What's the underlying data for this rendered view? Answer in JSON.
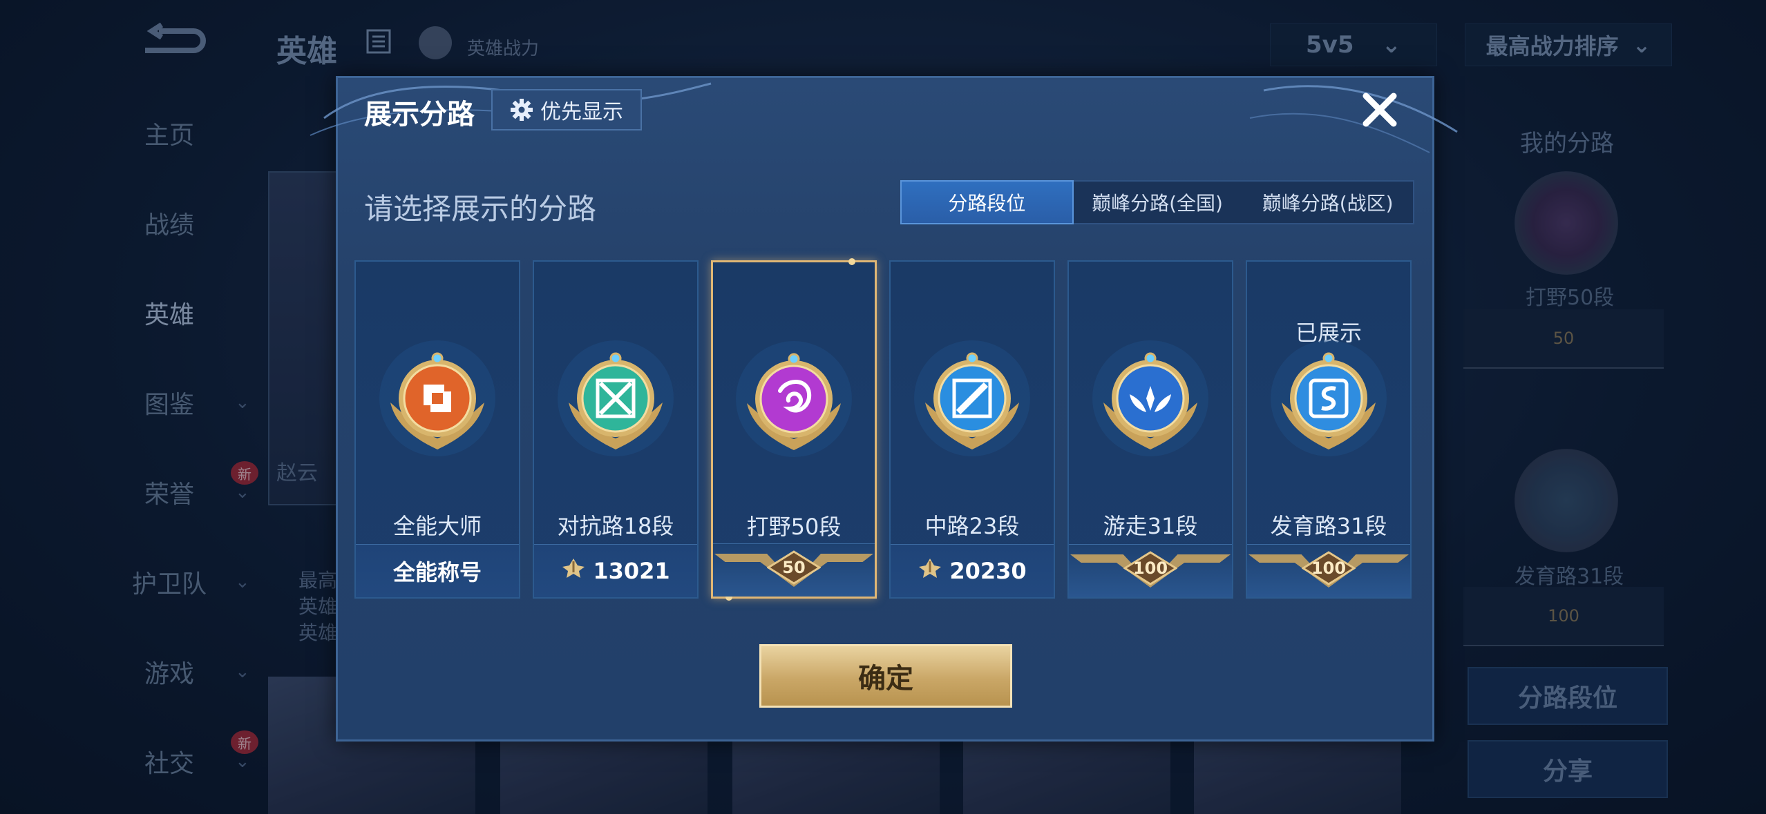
{
  "background": {
    "header_title": "英雄",
    "power_label": "英雄战力",
    "mode_select": "5v5",
    "sort_select": "最高战力排序",
    "nav": [
      {
        "label": "主页",
        "chevron": false,
        "new": false
      },
      {
        "label": "战绩",
        "chevron": false,
        "new": false
      },
      {
        "label": "英雄",
        "chevron": false,
        "new": false,
        "active": true
      },
      {
        "label": "图鉴",
        "chevron": true,
        "new": false
      },
      {
        "label": "荣誉",
        "chevron": true,
        "new": true
      },
      {
        "label": "护卫队",
        "chevron": true,
        "new": false
      },
      {
        "label": "游戏",
        "chevron": true,
        "new": false
      },
      {
        "label": "社交",
        "chevron": true,
        "new": true
      }
    ],
    "new_badge": "新",
    "hero_tag": "赵云",
    "hero_lines": [
      "最高",
      "英雄",
      "英雄"
    ],
    "right_panel": {
      "title": "我的分路",
      "item1_label": "打野50段",
      "item1_rank": "50",
      "item2_label": "发育路31段",
      "item2_rank": "100",
      "btn_lane_rank": "分路段位",
      "btn_share": "分享"
    }
  },
  "dialog": {
    "title": "展示分路",
    "priority_button": "优先显示",
    "subtitle": "请选择展示的分路",
    "tabs": [
      {
        "label": "分路段位",
        "active": true
      },
      {
        "label": "巅峰分路(全国)",
        "active": false
      },
      {
        "label": "巅峰分路(战区)",
        "active": false
      }
    ],
    "cards": [
      {
        "name": "全能大师",
        "footer_type": "text",
        "footer": "全能称号",
        "shown": "",
        "selected": false,
        "emblem_color": "#e0642a",
        "emblem_icon": "allround-icon"
      },
      {
        "name": "对抗路18段",
        "footer_type": "score",
        "footer": "13021",
        "shown": "",
        "selected": false,
        "emblem_color": "#2fb59a",
        "emblem_icon": "clash-lane-icon"
      },
      {
        "name": "打野50段",
        "footer_type": "rank",
        "footer": "50",
        "shown": "",
        "selected": true,
        "emblem_color": "#b23ad1",
        "emblem_icon": "jungle-dragon-icon"
      },
      {
        "name": "中路23段",
        "footer_type": "score",
        "footer": "20230",
        "shown": "",
        "selected": false,
        "emblem_color": "#2a8ee0",
        "emblem_icon": "mid-lane-icon"
      },
      {
        "name": "游走31段",
        "footer_type": "rank",
        "footer": "100",
        "shown": "",
        "selected": false,
        "emblem_color": "#2a6fd0",
        "emblem_icon": "roam-wings-icon"
      },
      {
        "name": "发育路31段",
        "footer_type": "rank",
        "footer": "100",
        "shown": "已展示",
        "selected": false,
        "emblem_color": "#2f8de0",
        "emblem_icon": "farm-lane-icon"
      }
    ],
    "confirm_button": "确定"
  },
  "colors": {
    "accent_blue": "#2f6fbf",
    "gold": "#e0b775",
    "card_bg": "#1b3c6a"
  }
}
